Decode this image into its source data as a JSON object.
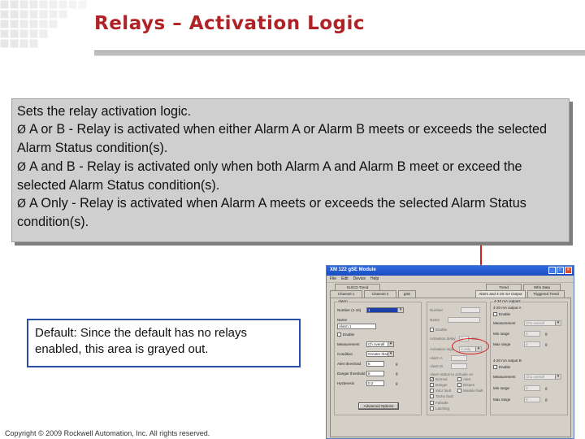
{
  "slide": {
    "title": "Relays – Activation Logic",
    "copyright": "Copyright © 2009 Rockwell Automation, Inc. All rights reserved."
  },
  "description": {
    "intro": "Sets the relay activation logic.",
    "bullet_symbol": "Ø",
    "bullets": [
      "A or B - Relay is activated when either Alarm A or Alarm B meets or exceeds the selected Alarm Status condition(s).",
      "A and B - Relay is activated only when both Alarm A and Alarm B meet or exceed the selected Alarm Status condition(s).",
      "A Only - Relay is activated when Alarm A meets or exceeds the selected Alarm Status condition(s)."
    ]
  },
  "default_note": "Default:  Since the default has no relays enabled, this area is grayed out.",
  "colors": {
    "title": "#b02226",
    "callout_fill": "#cfcfcf",
    "default_border": "#2a4fa8",
    "highlight": "#d41f1f",
    "titlebar": "#1b4cc0"
  },
  "window": {
    "title": "XM 122 gSE Module",
    "menu": [
      "File",
      "Edit",
      "Device",
      "Help"
    ],
    "tabs_top": [
      "SU/CD Trend",
      "Trend",
      "Wfm Data"
    ],
    "tabs_bottom": [
      "Channel 1",
      "Channel 2",
      "gSE",
      "Alarm and 4-20 mA Output",
      "Triggered Trend"
    ],
    "alarm": {
      "group": "Alarm",
      "number_label": "Number (1-16)",
      "number_value": "1",
      "name_label": "Name",
      "name_value": "Alarm 1",
      "enable_label": "Enable",
      "measurement_label": "Measurement",
      "measurement_value": "Ch overall",
      "condition_label": "Condition",
      "condition_value": "Greater than",
      "alert_threshold_label": "Alert threshold",
      "alert_threshold_value": "6",
      "danger_threshold_label": "Danger threshold",
      "danger_threshold_value": "8",
      "hysteresis_label": "Hysteresis",
      "hysteresis_value": "0.2",
      "unit": "g",
      "advanced_button": "Advanced Options"
    },
    "relay": {
      "number_label": "Number",
      "name_label": "Name",
      "enable_label": "Enable",
      "activation_delay_label": "Activation delay",
      "activation_delay_value": "1",
      "activation_delay_unit": "Sec",
      "activation_logic_label": "Activation logic",
      "activation_logic_value": "A only",
      "alarm_a_label": "Alarm A",
      "alarm_b_label": "Alarm B",
      "alarm_status_label": "Alarm status to activate on",
      "status_checks": [
        {
          "label": "Normal",
          "checked": true
        },
        {
          "label": "Alert",
          "checked": false
        },
        {
          "label": "Danger",
          "checked": false
        },
        {
          "label": "Disarm",
          "checked": false
        },
        {
          "label": "Xdcr fault",
          "checked": false
        },
        {
          "label": "Module fault",
          "checked": false
        },
        {
          "label": "Tacho fault",
          "checked": false
        }
      ],
      "failsafe_label": "Failsafe",
      "latching_label": "Latching"
    },
    "output_a": {
      "group": "4-20 mA outputs",
      "title": "4-20 mA output A",
      "enable_label": "Enable",
      "measurement_label": "Measurement",
      "measurement_value": "Ch1 overall",
      "min_range_label": "Min range",
      "min_range_value": "0",
      "max_range_label": "Max range",
      "max_range_value": "0",
      "unit": "g"
    },
    "output_b": {
      "title": "4-20 mA output B",
      "enable_label": "Enable",
      "measurement_label": "Measurement",
      "measurement_value": "Ch1 overall",
      "min_range_label": "Min range",
      "min_range_value": "0",
      "max_range_label": "Max range",
      "max_range_value": "0",
      "unit": "g"
    }
  }
}
